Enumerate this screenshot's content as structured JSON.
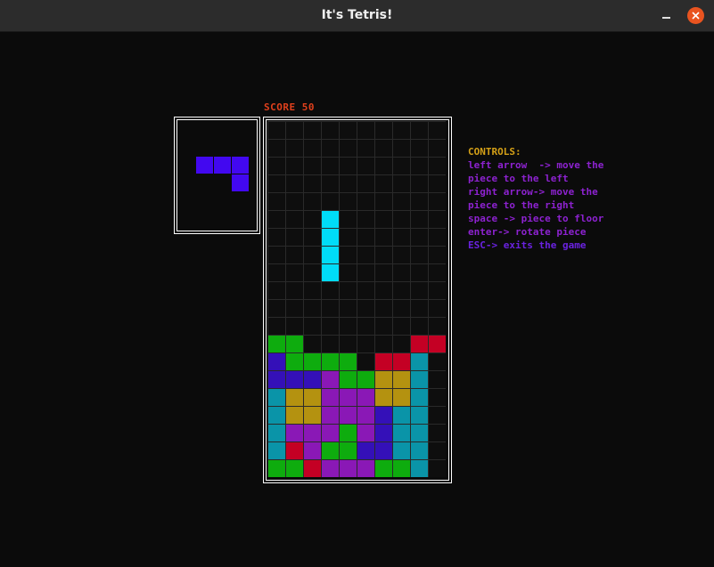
{
  "window": {
    "title": "It's Tetris!",
    "buttons": [
      "minimize-icon",
      "close-icon"
    ]
  },
  "game": {
    "score_label": "SCORE 50",
    "score": 50,
    "board": {
      "columns": 10,
      "rows": 20
    },
    "colors": {
      "G": "#0eac0e",
      "T": "#0a94a8",
      "R": "#c40024",
      "Y": "#b49210",
      "P": "#8a18b6",
      "B": "#3410b8",
      "C": "#00dcf8",
      "N": "#4208f0"
    },
    "rows": [
      "..........",
      "..........",
      "..........",
      "..........",
      "..........",
      "...C......",
      "...C......",
      "...C......",
      "...C......",
      "..........",
      "..........",
      "..........",
      "GG......RR",
      "BGGGG.RRT.",
      "BBBPGGYYT.",
      "TYYPPPYYT.",
      "TYYPPPBTT.",
      "TPPPGPBTT.",
      "TRPGGBBTT.",
      "GGRPPPGGT."
    ],
    "next_piece": {
      "color": "N",
      "cells": [
        [
          0,
          0
        ],
        [
          1,
          0
        ],
        [
          2,
          0
        ],
        [
          2,
          1
        ]
      ]
    }
  },
  "controls": {
    "title": "CONTROLS:",
    "lines": [
      "left arrow  -> move the",
      "piece to the left",
      "right arrow-> move the",
      "piece to the right",
      "space -> piece to floor",
      "enter-> rotate piece",
      "ESC-> exits the game"
    ]
  }
}
